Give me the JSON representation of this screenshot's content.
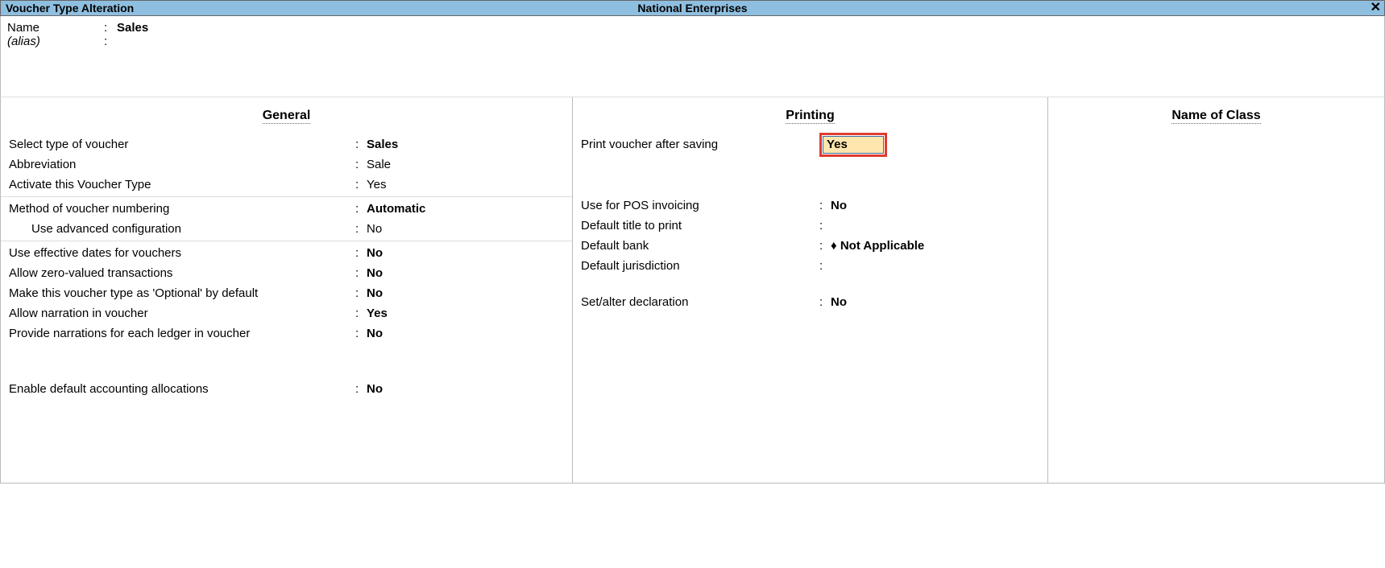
{
  "titlebar": {
    "left": "Voucher Type Alteration",
    "center": "National Enterprises",
    "close": "✕"
  },
  "header": {
    "name_label": "Name",
    "name_value": "Sales",
    "alias_label": "(alias)",
    "alias_value": ""
  },
  "general": {
    "title": "General",
    "select_type_label": "Select type of voucher",
    "select_type_value": "Sales",
    "abbreviation_label": "Abbreviation",
    "abbreviation_value": "Sale",
    "activate_label": "Activate this Voucher Type",
    "activate_value": "Yes",
    "numbering_label": "Method of voucher numbering",
    "numbering_value": "Automatic",
    "advconfig_label": "Use advanced configuration",
    "advconfig_value": "No",
    "effdates_label": "Use effective dates for vouchers",
    "effdates_value": "No",
    "zero_label": "Allow zero-valued transactions",
    "zero_value": "No",
    "optional_label": "Make this voucher type as 'Optional' by default",
    "optional_value": "No",
    "narration_label": "Allow narration in voucher",
    "narration_value": "Yes",
    "narration_each_label": "Provide narrations for each ledger in voucher",
    "narration_each_value": "No",
    "alloc_label": "Enable default accounting allocations",
    "alloc_value": "No"
  },
  "printing": {
    "title": "Printing",
    "print_after_label": "Print voucher after saving",
    "print_after_value": "Yes",
    "pos_label": "Use for POS invoicing",
    "pos_value": "No",
    "default_title_label": "Default title to print",
    "default_title_value": "",
    "default_bank_label": "Default bank",
    "default_bank_value": "♦ Not Applicable",
    "jurisdiction_label": "Default jurisdiction",
    "jurisdiction_value": "",
    "declaration_label": "Set/alter declaration",
    "declaration_value": "No"
  },
  "class": {
    "title": "Name of Class"
  }
}
